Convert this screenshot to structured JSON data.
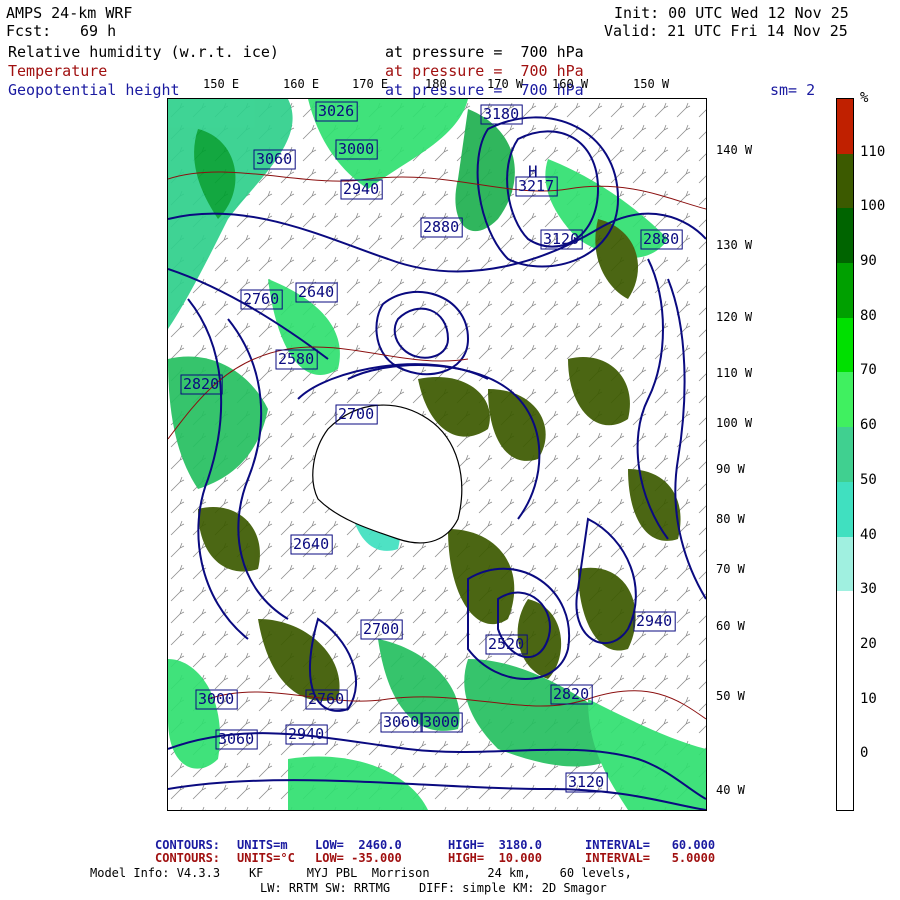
{
  "header": {
    "model": "AMPS 24-km WRF",
    "fcst_label": "Fcst:",
    "fcst_value": "69 h",
    "init": "Init: 00 UTC Wed 12 Nov 25",
    "valid": "Valid: 21 UTC Fri 14 Nov 25",
    "field1": "Relative humidity (w.r.t. ice)",
    "field1_level": "at pressure =  700 hPa",
    "field2": "Temperature",
    "field2_level": "at pressure =  700 hPa",
    "field3": "Geopotential height",
    "field3_level": "at pressure =  700 hPa",
    "smoothing": "sm= 2"
  },
  "map": {
    "lon_labels_top": [
      "150 E",
      "160 E",
      "170 E",
      "180",
      "170 W",
      "160 W",
      "150 W"
    ],
    "lat_labels_right": [
      "140 W",
      "130 W",
      "120 W",
      "110 W",
      "100 W",
      "90 W",
      "80 W",
      "70 W",
      "60 W",
      "50 W",
      "40 W"
    ],
    "height_labels": [
      "3000",
      "3060",
      "2940",
      "3026",
      "2880",
      "2760",
      "2640",
      "2820",
      "2700",
      "2580",
      "3120",
      "3180",
      "3217",
      "2940",
      "2880",
      "2760",
      "2640",
      "2520",
      "3000",
      "3060",
      "3120",
      "3060",
      "3000",
      "2940",
      "2820",
      "2700"
    ],
    "high_marker": "H",
    "colors": {
      "contour_height": "#0a0a80",
      "contour_temp": "#8b1010",
      "coast": "#000000"
    }
  },
  "colorbar": {
    "unit": "%",
    "labels": [
      "110",
      "100",
      "90",
      "80",
      "70",
      "60",
      "50",
      "40",
      "30",
      "20",
      "10",
      "0"
    ],
    "segments": [
      {
        "color": "#c02000"
      },
      {
        "color": "#3c5a00"
      },
      {
        "color": "#006400"
      },
      {
        "color": "#00a000"
      },
      {
        "color": "#00e000"
      },
      {
        "color": "#40f060"
      },
      {
        "color": "#40d090"
      },
      {
        "color": "#40e0c0"
      },
      {
        "color": "#a0f0e0"
      },
      {
        "color": "#ffffff"
      },
      {
        "color": "#ffffff"
      },
      {
        "color": "#ffffff"
      },
      {
        "color": "#ffffff"
      }
    ]
  },
  "footer": {
    "c1_label": "CONTOURS:",
    "c1_units": "UNITS=m",
    "c1_low": "LOW=  2460.0",
    "c1_high": "HIGH=  3180.0",
    "c1_interval": "INTERVAL=   60.000",
    "c2_label": "CONTOURS:",
    "c2_units": "UNITS=°C",
    "c2_low": "LOW= -35.000",
    "c2_high": "HIGH=  10.000",
    "c2_interval": "INTERVAL=   5.0000",
    "model_info": "Model Info: V4.3.3    KF      MYJ PBL  Morrison        24 km,    60 levels,",
    "model_info2": "LW: RRTM SW: RRTMG    DIFF: simple KM: 2D Smagor"
  }
}
